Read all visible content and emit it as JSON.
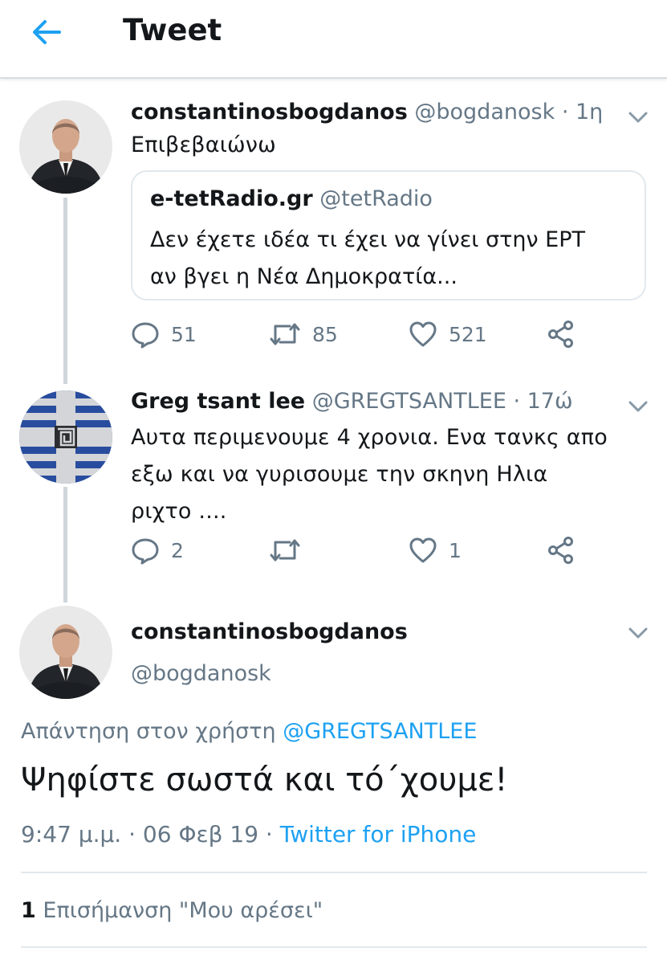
{
  "header": {
    "title": "Tweet",
    "back_icon": "arrow-left-icon"
  },
  "colors": {
    "accent": "#1da1f2",
    "muted": "#657786",
    "text": "#14171a",
    "border": "#e1e8ed"
  },
  "tweet1": {
    "name": "constantinosbogdanos",
    "handle": "@bogdanosk",
    "time": "· 1η",
    "text": "Επιβεβαιώνω",
    "quote": {
      "name": "e-tetRadio.gr",
      "handle": "@tetRadio",
      "text_line1": "Δεν έχετε ιδέα τι έχει να γίνει στην ΕΡΤ",
      "text_line2": "αν βγει η Νέα Δημοκρατία..."
    },
    "replies": "51",
    "retweets": "85",
    "likes": "521"
  },
  "tweet2": {
    "name": "Greg tsant lee",
    "handle": "@GREGTSANTLEE",
    "time": "· 17ώ",
    "text_line1": "Αυτα περιμενουμε 4 χρονια. Ενα τανκς απο",
    "text_line2": "εξω και να γυρισουμε την σκηνη Ηλια",
    "text_line3": "ριχτο ....",
    "replies": "2",
    "retweets": "",
    "likes": "1"
  },
  "main": {
    "name": "constantinosbogdanos",
    "handle": "@bogdanosk",
    "reply_prefix": "Απάντηση στον χρήστη ",
    "reply_mention": "@GREGTSANTLEE",
    "text": "Ψηφίστε σωστά και τό΄χουμε!",
    "time": "9:47 μ.μ. · 06 Φεβ 19 · ",
    "source": "Twitter for iPhone",
    "likes_count": "1",
    "likes_label": " Επισήμανση \"Μου αρέσει\""
  }
}
